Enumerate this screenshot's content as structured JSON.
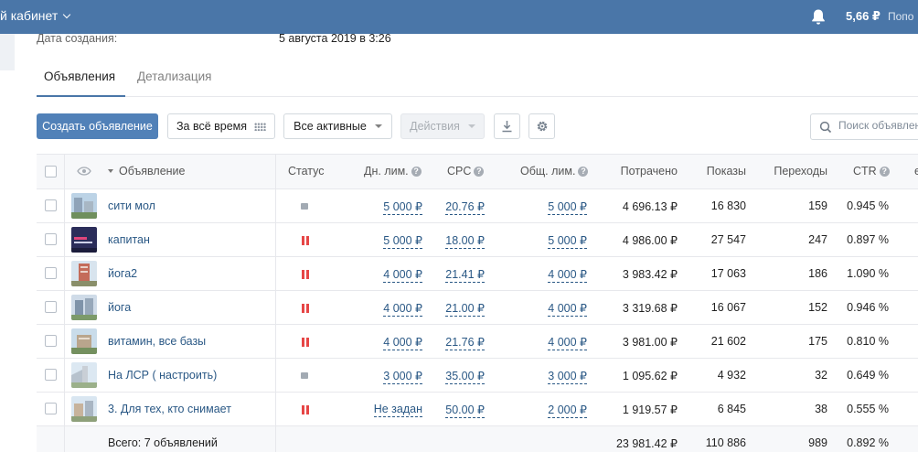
{
  "topbar": {
    "title": "й кабинет",
    "balance": "5,66 ₽",
    "topup": "Попо",
    "icons": {
      "bell": "bell-icon",
      "chevron": "chevron-down-icon"
    },
    "colors": {
      "bar": "#4a76a8"
    }
  },
  "info": {
    "created_label": "Дата создания:",
    "created_value": "5 августа 2019 в 3:26"
  },
  "tabs": [
    {
      "label": "Объявления",
      "active": true
    },
    {
      "label": "Детализация",
      "active": false
    }
  ],
  "toolbar": {
    "create_label": "Создать объявление",
    "period_label": "За всё время",
    "filter_label": "Все активные",
    "actions_label": "Действия",
    "search_placeholder": "Поиск объявлен",
    "icons": {
      "period": "calendar-grid-icon",
      "download": "download-icon",
      "settings": "gear-icon",
      "search": "search-icon"
    }
  },
  "table": {
    "headers": {
      "ad": "Объявление",
      "status": "Статус",
      "daily_limit": "Дн. лим.",
      "cpc": "CPC",
      "total_limit": "Общ. лим.",
      "spent": "Потрачено",
      "impressions": "Показы",
      "clicks": "Переходы",
      "ctr": "CTR",
      "cut": "е"
    },
    "rows": [
      {
        "name": "сити мол",
        "status": "stopped",
        "daily_limit": "5 000 ₽",
        "cpc": "20.76 ₽",
        "total_limit": "5 000 ₽",
        "spent": "4 696.13 ₽",
        "impressions": "16 830",
        "clicks": "159",
        "ctr": "0.945 %"
      },
      {
        "name": "капитан",
        "status": "paused",
        "daily_limit": "5 000 ₽",
        "cpc": "18.00 ₽",
        "total_limit": "5 000 ₽",
        "spent": "4 986.00 ₽",
        "impressions": "27 547",
        "clicks": "247",
        "ctr": "0.897 %"
      },
      {
        "name": "йога2",
        "status": "paused",
        "daily_limit": "4 000 ₽",
        "cpc": "21.41 ₽",
        "total_limit": "4 000 ₽",
        "spent": "3 983.42 ₽",
        "impressions": "17 063",
        "clicks": "186",
        "ctr": "1.090 %"
      },
      {
        "name": "йога",
        "status": "paused",
        "daily_limit": "4 000 ₽",
        "cpc": "21.00 ₽",
        "total_limit": "4 000 ₽",
        "spent": "3 319.68 ₽",
        "impressions": "16 067",
        "clicks": "152",
        "ctr": "0.946 %"
      },
      {
        "name": "витамин, все базы",
        "status": "paused",
        "daily_limit": "4 000 ₽",
        "cpc": "21.76 ₽",
        "total_limit": "4 000 ₽",
        "spent": "3 981.00 ₽",
        "impressions": "21 602",
        "clicks": "175",
        "ctr": "0.810 %"
      },
      {
        "name": "На ЛСР ( настроить)",
        "status": "stopped",
        "daily_limit": "3 000 ₽",
        "cpc": "35.00 ₽",
        "total_limit": "3 000 ₽",
        "spent": "1 095.62 ₽",
        "impressions": "4 932",
        "clicks": "32",
        "ctr": "0.649 %"
      },
      {
        "name": "3. Для тех, кто снимает",
        "status": "paused",
        "daily_limit": "Не задан",
        "cpc": "50.00 ₽",
        "total_limit": "2 000 ₽",
        "spent": "1 919.57 ₽",
        "impressions": "6 845",
        "clicks": "38",
        "ctr": "0.555 %"
      }
    ],
    "total": {
      "label": "Всего: 7 объявлений",
      "spent": "23 981.42 ₽",
      "impressions": "110 886",
      "clicks": "989",
      "ctr": "0.892 %"
    },
    "status_colors": {
      "paused": "#e64646",
      "stopped": "#a2aab3"
    }
  }
}
